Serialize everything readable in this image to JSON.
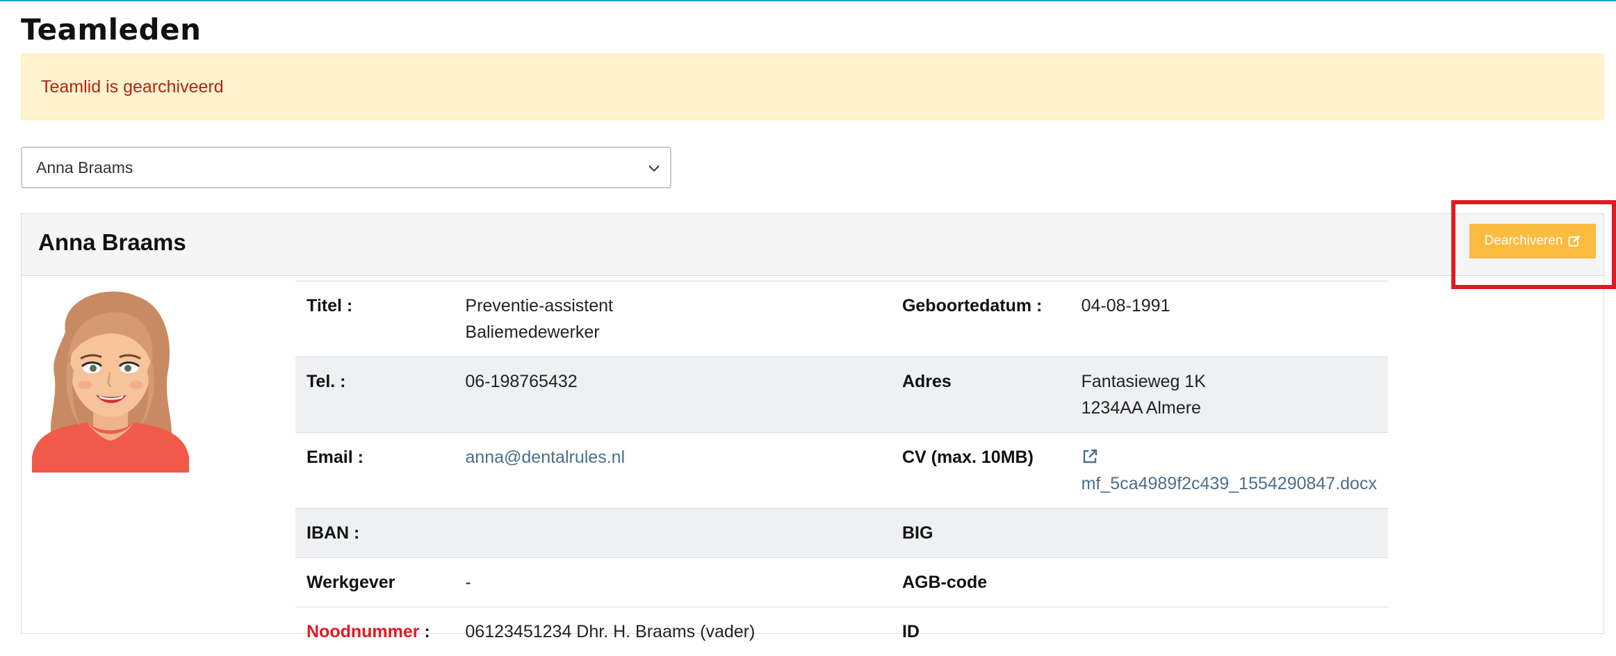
{
  "page": {
    "title": "Teamleden"
  },
  "alert": {
    "message": "Teamlid is gearchiveerd"
  },
  "selector": {
    "selected": "Anna Braams"
  },
  "card": {
    "title": "Anna Braams",
    "button_label": "Dearchiveren"
  },
  "details": {
    "titel_label": "Titel :",
    "titel_value_1": "Preventie-assistent",
    "titel_value_2": "Baliemedewerker",
    "geboortedatum_label": "Geboortedatum :",
    "geboortedatum_value": "04-08-1991",
    "tel_label": "Tel. :",
    "tel_value": "06-198765432",
    "adres_label": "Adres",
    "adres_value_1": "Fantasieweg 1K",
    "adres_value_2": "1234AA Almere",
    "email_label": "Email :",
    "email_value": "anna@dentalrules.nl",
    "cv_label": "CV (max. 10MB)",
    "cv_value": "mf_5ca4989f2c439_1554290847.docx",
    "iban_label": "IBAN :",
    "iban_value": "",
    "big_label": "BIG",
    "big_value": "",
    "werkgever_label": "Werkgever",
    "werkgever_value": "-",
    "agb_label": "AGB-code",
    "agb_value": "",
    "nood_label": "Noodnummer",
    "nood_colon": " :",
    "nood_value": "06123451234 Dhr. H. Braams (vader)",
    "id_label": "ID",
    "id_value": ""
  },
  "colors": {
    "accent_line": "#2a9fd6",
    "alert_bg": "#fff3cd",
    "alert_text": "#b42318",
    "button": "#fbbb3f",
    "highlight": "#e11a22",
    "link": "#4a6f8a"
  },
  "icons": {
    "chevron": "chevron-down-icon",
    "edit": "edit-icon",
    "external_link": "external-link-icon",
    "avatar": "avatar-illustration"
  }
}
